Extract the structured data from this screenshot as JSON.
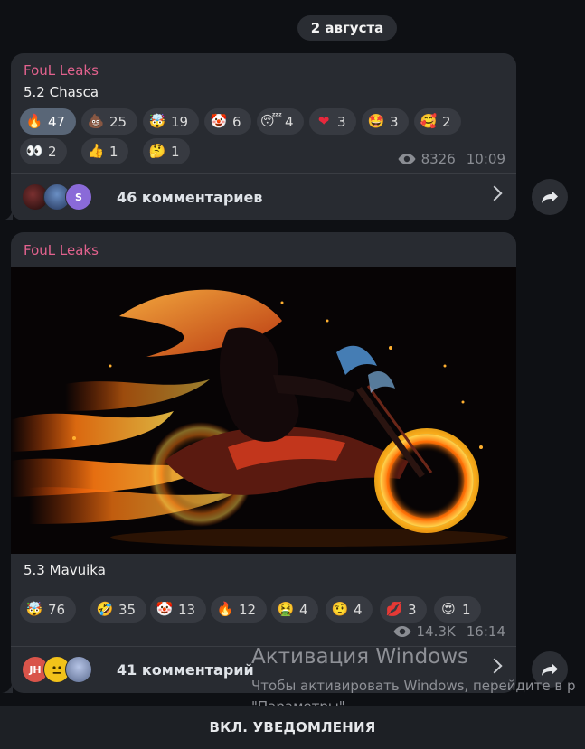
{
  "date_separator": "2 августа",
  "post1": {
    "author": "FouL Leaks",
    "text": "5.2 Chasca",
    "reactions": [
      {
        "emoji": "🔥",
        "count": "47",
        "active": true
      },
      {
        "emoji": "💩",
        "count": "25"
      },
      {
        "emoji": "🤯",
        "count": "19"
      },
      {
        "emoji": "🤡",
        "count": "6"
      },
      {
        "emoji": "😴",
        "count": "4"
      },
      {
        "emoji": "❤",
        "count": "3"
      },
      {
        "emoji": "🤩",
        "count": "3"
      },
      {
        "emoji": "🥰",
        "count": "2"
      },
      {
        "emoji": "👀",
        "count": "2"
      },
      {
        "emoji": "👍",
        "count": "1"
      },
      {
        "emoji": "🤔",
        "count": "1"
      }
    ],
    "views": "8326",
    "time": "10:09",
    "comments_label": "46 комментариев",
    "avatar_letters": [
      "",
      "",
      "S"
    ]
  },
  "post2": {
    "author": "FouL Leaks",
    "text": "5.3 Mavuika",
    "reactions": [
      {
        "emoji": "🤯",
        "count": "76"
      },
      {
        "emoji": "🤣",
        "count": "35"
      },
      {
        "emoji": "🤡",
        "count": "13"
      },
      {
        "emoji": "🔥",
        "count": "12"
      },
      {
        "emoji": "🤮",
        "count": "4"
      },
      {
        "emoji": "🤨",
        "count": "4"
      },
      {
        "emoji": "💋",
        "count": "3"
      },
      {
        "emoji": "😍",
        "count": "1"
      }
    ],
    "views": "14.3K",
    "time": "16:14",
    "comments_label": "41 комментарий",
    "avatar_letters": [
      "JH",
      "",
      ""
    ]
  },
  "watermark": {
    "title": "Активация Windows",
    "line1": "Чтобы активировать Windows, перейдите в р",
    "line2": "\"Параметры\"."
  },
  "bottom_button": "ВКЛ. УВЕДОМЛЕНИЯ",
  "colors": {
    "author": "#e2628e",
    "bubble": "#282b31",
    "background": "#0e1014",
    "active_reaction": "#596677"
  }
}
